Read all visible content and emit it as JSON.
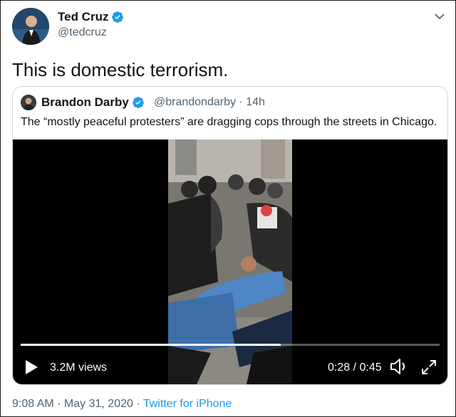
{
  "author": {
    "name": "Ted Cruz",
    "handle": "@tedcruz"
  },
  "tweet": {
    "text": "This is domestic terrorism."
  },
  "quoted": {
    "name": "Brandon Darby",
    "meta": "@brandondarby · 14h",
    "text": "The “mostly peaceful protesters” are dragging cops through the streets in Chicago."
  },
  "video": {
    "views": "3.2M views",
    "time": "0:28 / 0:45",
    "progress": 0.62
  },
  "footer": {
    "timestamp": "9:08 AM · May 31, 2020 · ",
    "source": "Twitter for iPhone"
  },
  "colors": {
    "verified": "#1d9bf0",
    "link": "#1d9bf0",
    "muted": "#536471"
  },
  "icons": [
    "verified-badge-icon",
    "chevron-down-icon",
    "play-icon",
    "volume-icon",
    "fullscreen-icon"
  ]
}
